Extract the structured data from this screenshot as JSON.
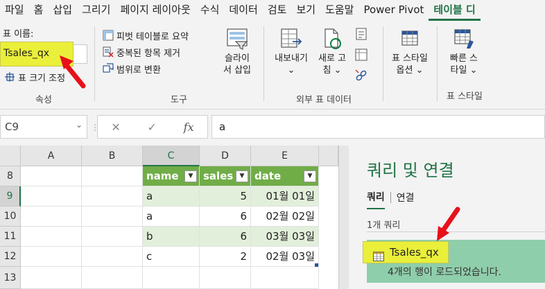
{
  "ribbon_tabs": [
    "파일",
    "홈",
    "삽입",
    "그리기",
    "페이지 레이아웃",
    "수식",
    "데이터",
    "검토",
    "보기",
    "도움말",
    "Power Pivot",
    "테이블 디"
  ],
  "properties": {
    "name_label": "표 이름:",
    "name_value": "Tsales_qx",
    "resize_label": "표 크기 조정",
    "group_label": "속성"
  },
  "tools": {
    "pivot": "피벗 테이블로 요약",
    "dedupe": "중복된 항목 제거",
    "convert": "범위로 변환",
    "slicer_line1": "슬라이",
    "slicer_line2": "서 삽입",
    "group_label": "도구"
  },
  "external": {
    "export": "내보내기",
    "refresh_line1": "새로 고",
    "refresh_line2": "침",
    "group_label": "외부 표 데이터"
  },
  "style_options": {
    "line1": "표 스타일",
    "line2": "옵션"
  },
  "quick_styles": {
    "line1": "빠른 스",
    "line2": "타일"
  },
  "styles_group_label": "표 스타일",
  "formula_bar": {
    "cell_ref": "C9",
    "fx": "fx",
    "value": "a"
  },
  "grid": {
    "columns": [
      "A",
      "B",
      "C",
      "D",
      "E"
    ],
    "rows": [
      "8",
      "9",
      "10",
      "11",
      "12",
      "13"
    ],
    "headers": [
      "name",
      "sales",
      "date"
    ],
    "data": [
      [
        "a",
        "5",
        "01월 01일"
      ],
      [
        "a",
        "6",
        "02월 02일"
      ],
      [
        "b",
        "6",
        "03월 03일"
      ],
      [
        "c",
        "2",
        "02월 03일"
      ]
    ]
  },
  "queries_pane": {
    "title": "쿼리 및 연결",
    "tab_queries": "쿼리",
    "tab_connections": "연결",
    "count": "1개 쿼리",
    "query_name": "Tsales_qx",
    "query_status": "4개의 행이 로드되었습니다."
  },
  "colors": {
    "excel_green": "#217346",
    "table_header": "#70ad47",
    "band": "#e2efda",
    "highlight": "#eaef3a",
    "arrow": "#e8101a"
  }
}
